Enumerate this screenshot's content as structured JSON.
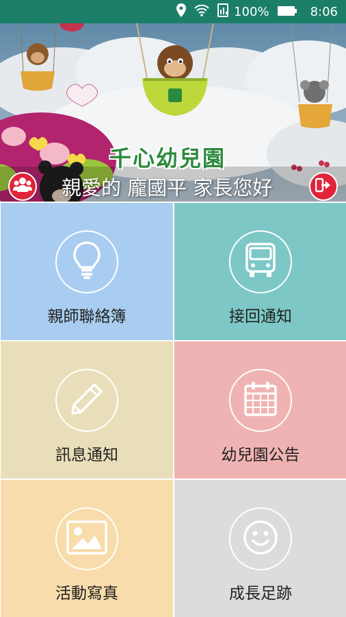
{
  "status_bar": {
    "battery_percent": "100%",
    "time": "8:06",
    "background": "#1b7f67"
  },
  "banner": {
    "logo_text": "千心幼兒園",
    "greeting": "親愛的 龐國平 家長您好",
    "group_icon": "group-icon",
    "exit_icon": "exit-icon"
  },
  "menu": [
    {
      "label": "親師聯絡簿",
      "icon": "lightbulb-icon",
      "color": "#a9cdf0"
    },
    {
      "label": "接回通知",
      "icon": "bus-icon",
      "color": "#7dc8c6"
    },
    {
      "label": "訊息通知",
      "icon": "pencil-icon",
      "color": "#e8deb9"
    },
    {
      "label": "幼兒園公告",
      "icon": "calendar-icon",
      "color": "#f0b3b3"
    },
    {
      "label": "活動寫真",
      "icon": "image-icon",
      "color": "#f8dcab"
    },
    {
      "label": "成長足跡",
      "icon": "smiley-icon",
      "color": "#dcdcdc"
    }
  ]
}
